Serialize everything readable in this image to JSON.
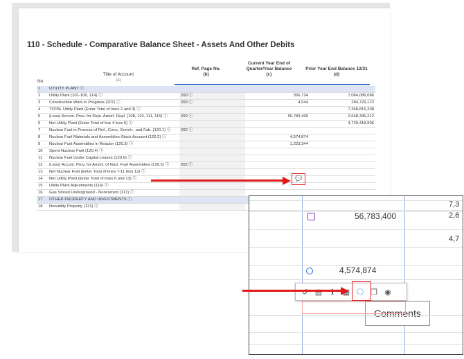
{
  "schedule_title": "110 - Schedule - Comparative Balance Sheet - Assets And Other Debits",
  "headers": {
    "no": "No.",
    "title": "Title of Account",
    "title_sub": "(a)",
    "ref": "Ref. Page No.",
    "ref_sub": "(b)",
    "current": "Current Year End of Quarter/Year Balance",
    "current_sub": "(c)",
    "prior": "Prior Year End Balance 12/31",
    "prior_sub": "(d)"
  },
  "rows": [
    {
      "no": "1",
      "title": "UTILITY PLANT ⓘ",
      "ref": "",
      "current": "",
      "prior": "",
      "section": true
    },
    {
      "no": "2",
      "title": "Utility Plant (101-106, 114) ⓘ",
      "ref": "200 ⓘ",
      "current": "356,734",
      "prior": "7,084,086,086"
    },
    {
      "no": "3",
      "title": "Construction Work in Progress (107) ⓘ",
      "ref": "200 ⓘ",
      "current": "4,544",
      "prior": "284,729,122"
    },
    {
      "no": "4",
      "title": "TOTAL Utility Plant (Enter Total of lines 2 and 3) ⓘ",
      "ref": "",
      "current": "",
      "prior": "7,368,815,208"
    },
    {
      "no": "5",
      "title": "(Less) Accum. Prov. for Depr. Amort. Depl. (108, 110, 111, 115) ⓘ",
      "ref": "200 ⓘ",
      "current": "56,783,400",
      "prior": "2,648,396,212",
      "current_icon": true
    },
    {
      "no": "6",
      "title": "Net Utility Plant (Enter Total of line 4 less 5) ⓘ",
      "ref": "",
      "current": "",
      "prior": "4,720,418,996"
    },
    {
      "no": "7",
      "title": "Nuclear Fuel in Process of Ref., Conv., Enrich., and Fab. (120.1) ⓘ",
      "ref": "202 ⓘ",
      "current": "",
      "prior": ""
    },
    {
      "no": "8",
      "title": "Nuclear Fuel Materials and Assemblies-Stock Account (120.2) ⓘ",
      "ref": "",
      "current": "4,574,874",
      "prior": "",
      "current_icon2": true
    },
    {
      "no": "9",
      "title": "Nuclear Fuel Assemblies in Reactor (120.3) ⓘ",
      "ref": "",
      "current": "1,223,344",
      "prior": ""
    },
    {
      "no": "10",
      "title": "Spent Nuclear Fuel (120.4) ⓘ",
      "ref": "",
      "current": "",
      "prior": ""
    },
    {
      "no": "11",
      "title": "Nuclear Fuel Under Capital Leases (120.6) ⓘ",
      "ref": "",
      "current": "",
      "prior": ""
    },
    {
      "no": "12",
      "title": "(Less) Accum. Prov. for Amort. of Nucl. Fuel Assemblies (120.5) ⓘ",
      "ref": "202 ⓘ",
      "current": "",
      "prior": ""
    },
    {
      "no": "13",
      "title": "Net Nuclear Fuel (Enter Total of lines 7-11 less 12) ⓘ",
      "ref": "",
      "current": "",
      "prior": ""
    },
    {
      "no": "14",
      "title": "Net Utility Plant (Enter Total of lines 6 and 13) ⓘ",
      "ref": "",
      "current": "",
      "prior": ""
    },
    {
      "no": "15",
      "title": "Utility Plant Adjustments (116) ⓘ",
      "ref": "",
      "current": "",
      "prior": ""
    },
    {
      "no": "16",
      "title": "Gas Stored Underground - Noncurrent (117) ⓘ",
      "ref": "",
      "current": "",
      "prior": ""
    },
    {
      "no": "17",
      "title": "OTHER PROPERTY AND INVESTMENTS ⓘ",
      "ref": "",
      "current": "",
      "prior": "",
      "section": true
    },
    {
      "no": "18",
      "title": "Nonutility Property (121) ⓘ",
      "ref": "",
      "current": "",
      "prior": ""
    }
  ],
  "zoom": {
    "top_right_1": "7,3",
    "value_1": "56,783,400",
    "right_1": "2,6",
    "right_2": "4,7",
    "value_2": "4,574,874",
    "tooltip": "Comments"
  },
  "colors": {
    "accent": "#3b72c4",
    "arrow": "#e01818",
    "section_bg": "#dde4f3"
  }
}
